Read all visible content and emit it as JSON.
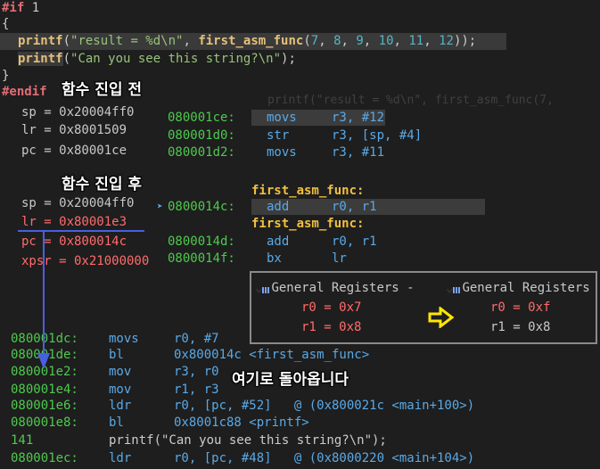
{
  "source": {
    "if_line": [
      "#if",
      " 1"
    ],
    "open_brace": "{",
    "line_printf1": {
      "fn": "printf",
      "open": "(",
      "str": "\"result = %d\\n\"",
      "comma": ", ",
      "call": "first_asm_func",
      "args_open": "(",
      "args": [
        "7",
        "8",
        "9",
        "10",
        "11",
        "12"
      ],
      "close": "));"
    },
    "line_printf2": {
      "fn": "printf",
      "open": "(",
      "str": "\"Can you see this string?\\n\"",
      "close": ");"
    },
    "close_brace": "}",
    "endif": "#endif"
  },
  "labels": {
    "before_call": "함수 진입 전",
    "after_call": "함수 진입 후",
    "return_here": "여기로 돌아옵니다"
  },
  "regs_before": [
    {
      "text": "sp = 0x20004ff0"
    },
    {
      "text": "lr = 0x8001509"
    },
    {
      "text": "pc = 0x80001ce"
    }
  ],
  "regs_after": [
    {
      "text": "sp = 0x20004ff0"
    },
    {
      "text": "lr = 0x80001e3"
    },
    {
      "text": "pc = 0x800014c"
    },
    {
      "text": "xpsr = 0x21000000"
    }
  ],
  "disasm_top": {
    "partial_line": "printf(\"result = %d\\n\", first_asm_func(7,",
    "rows": [
      {
        "addr": "080001ce:",
        "op": "movs",
        "args": "r3, #12"
      },
      {
        "addr": "080001d0:",
        "op": "str",
        "args": "r3, [sp, #4]"
      },
      {
        "addr": "080001d2:",
        "op": "movs",
        "args": "r3, #11"
      }
    ]
  },
  "disasm_func": {
    "label1": "first_asm_func:",
    "row1": {
      "addr": "0800014c:",
      "op": "add",
      "args": "r0, r1"
    },
    "label2": "first_asm_func:",
    "row2": {
      "addr": "0800014d:",
      "op": "add",
      "args": "r0, r1"
    },
    "row3": {
      "addr": "0800014f:",
      "op": "bx",
      "args": "lr"
    }
  },
  "panel": {
    "title_left": "General Registers -",
    "title_right": "General Registers",
    "left": [
      "r0 = 0x7",
      "r1 = 0x8"
    ],
    "right": [
      "r0 = 0xf",
      "r1 = 0x8"
    ]
  },
  "disasm_bottom": [
    {
      "addr": "080001dc:",
      "op": "movs",
      "args": "r0, #7"
    },
    {
      "addr": "080001de:",
      "op": "bl",
      "args": "0x800014c <first_asm_func>"
    },
    {
      "addr": "080001e2:",
      "op": "mov",
      "args": "r3, r0"
    },
    {
      "addr": "080001e4:",
      "op": "mov",
      "args": "r1, r3"
    },
    {
      "addr": "080001e6:",
      "op": "ldr",
      "args": "r0, [pc, #52]   @ (0x800021c <main+100>)"
    },
    {
      "addr": "080001e8:",
      "op": "bl",
      "args": "0x8001c88 <printf>"
    },
    {
      "addr": "141",
      "op": "printf(\"Can you see this string?\\n\");",
      "args": ""
    },
    {
      "addr": "080001ec:",
      "op": "ldr",
      "args": "r0, [pc, #48]   @ (0x8000220 <main+104>)"
    }
  ],
  "colors": {
    "accent_arrow": "#4a5fe0",
    "yellow_arrow": "#ffe600"
  }
}
